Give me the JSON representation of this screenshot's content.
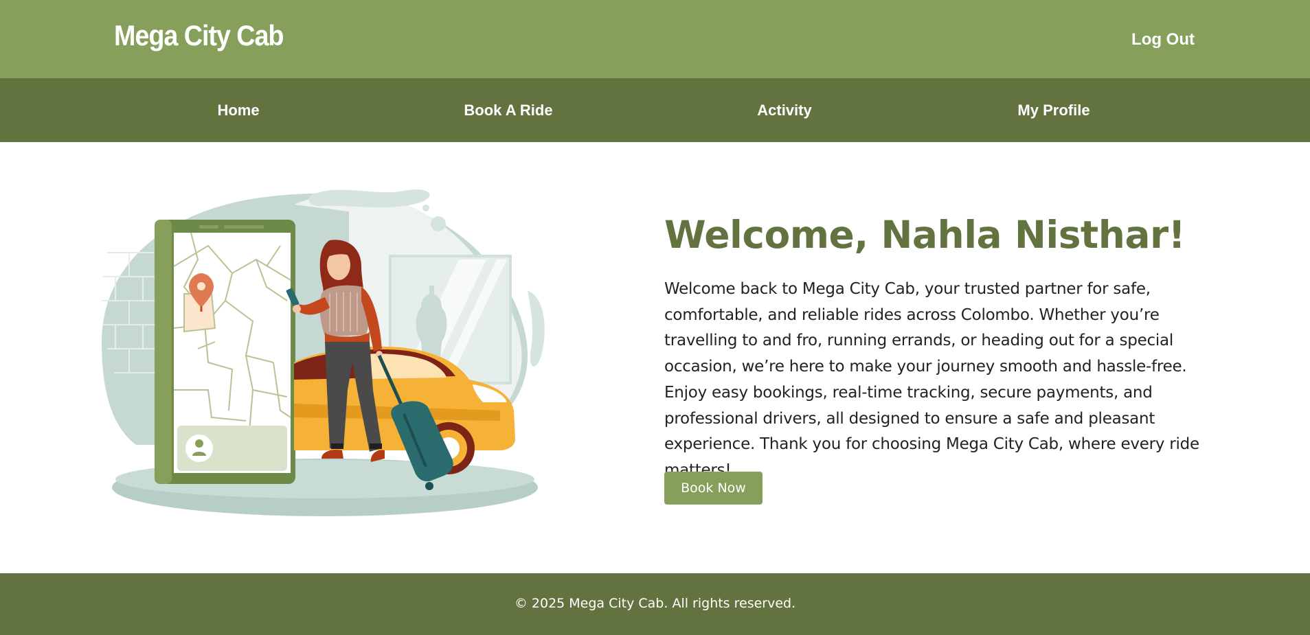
{
  "header": {
    "brand": "Mega City Cab",
    "logout_label": "Log Out"
  },
  "nav": {
    "items": [
      {
        "label": "Home"
      },
      {
        "label": "Book A Ride"
      },
      {
        "label": "Activity"
      },
      {
        "label": "My Profile"
      }
    ]
  },
  "hero": {
    "illustration": "woman-with-luggage-and-taxi-map-illustration",
    "title": "Welcome, Nahla Nisthar!",
    "description": "Welcome back to Mega City Cab, your trusted partner for safe, comfortable, and reliable rides across Colombo. Whether you’re travelling to and fro, running errands, or heading out for a special occasion, we’re here to make your journey smooth and hassle-free. Enjoy easy bookings, real-time tracking, secure payments, and professional drivers, all designed to ensure a safe and pleasant experience. Thank you for choosing Mega City Cab, where every ride matters!",
    "cta_label": "Book Now"
  },
  "footer": {
    "copyright": "© 2025 Mega City Cab. All rights reserved."
  },
  "colors": {
    "header_green": "#86a05c",
    "nav_dark_green": "#627340",
    "title_green": "#627340",
    "taxi_yellow": "#f6b236",
    "accent_orange": "#c4481e"
  }
}
